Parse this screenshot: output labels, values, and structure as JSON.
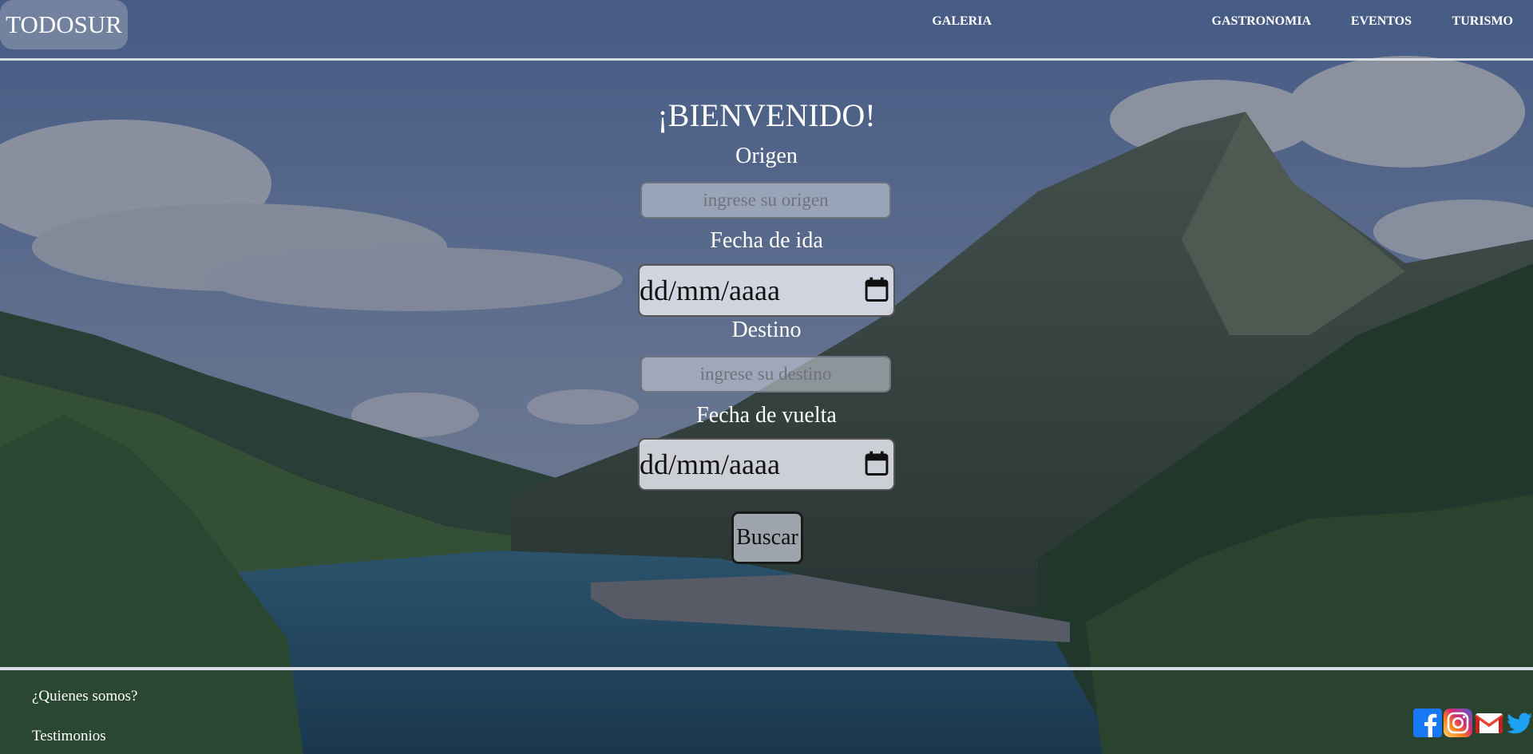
{
  "brand": {
    "logo": "TODOSUR"
  },
  "nav": {
    "items": [
      {
        "label": "GALERIA"
      },
      {
        "label": "GASTRONOMIA"
      },
      {
        "label": "EVENTOS"
      },
      {
        "label": "TURISMO"
      }
    ]
  },
  "main": {
    "title": "¡BIENVENIDO!",
    "origin": {
      "label": "Origen",
      "placeholder": "ingrese su origen",
      "value": ""
    },
    "departure": {
      "label": "Fecha de ida",
      "value": "dd/mm/aaaa"
    },
    "destination": {
      "label": "Destino",
      "placeholder": "ingrese su destino",
      "value": ""
    },
    "return": {
      "label": "Fecha de vuelta",
      "value": "dd/mm/aaaa"
    },
    "search_button": "Buscar"
  },
  "footer": {
    "links": [
      {
        "label": "¿Quienes somos?"
      },
      {
        "label": "Testimonios"
      }
    ],
    "socials": [
      {
        "icon": "facebook-icon",
        "color": "#1877f2"
      },
      {
        "icon": "instagram-icon",
        "color": "#d62976"
      },
      {
        "icon": "gmail-icon",
        "color": "#ea4335"
      },
      {
        "icon": "twitter-icon",
        "color": "#1da1f2"
      }
    ]
  }
}
